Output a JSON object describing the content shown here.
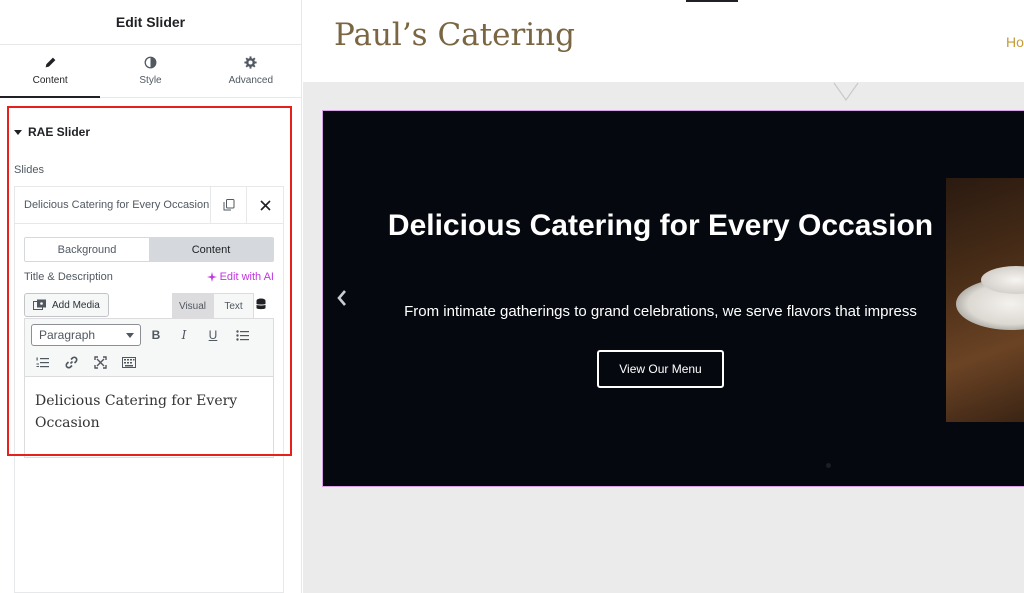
{
  "panel": {
    "title": "Edit Slider",
    "tabs": [
      {
        "label": "Content",
        "icon": "pencil-icon",
        "active": true
      },
      {
        "label": "Style",
        "icon": "contrast-icon",
        "active": false
      },
      {
        "label": "Advanced",
        "icon": "gear-icon",
        "active": false
      }
    ],
    "section_title": "RAE Slider",
    "slides_label": "Slides",
    "slide_item_title": "Delicious Catering for Every Occasion",
    "inner_tabs": [
      "Background",
      "Content"
    ],
    "field_label": "Title & Description",
    "ai_link": "Edit with AI",
    "add_media": "Add Media",
    "editor_modes": [
      "Visual",
      "Text"
    ],
    "format_select": "Paragraph",
    "editor_content": "Delicious Catering for Every Occasion"
  },
  "preview": {
    "site_logo": "Paul’s Catering",
    "nav_partial": "Ho",
    "slide": {
      "title": "Delicious Catering for Every Occasion",
      "description": "From intimate gatherings to grand celebrations, we serve flavors that impress",
      "button": "View Our Menu"
    }
  },
  "colors": {
    "highlight_border": "#e8201c",
    "ai_accent": "#c036e0",
    "logo": "#7a6642",
    "nav": "#c29b3b",
    "slider_bg": "#05090f"
  }
}
